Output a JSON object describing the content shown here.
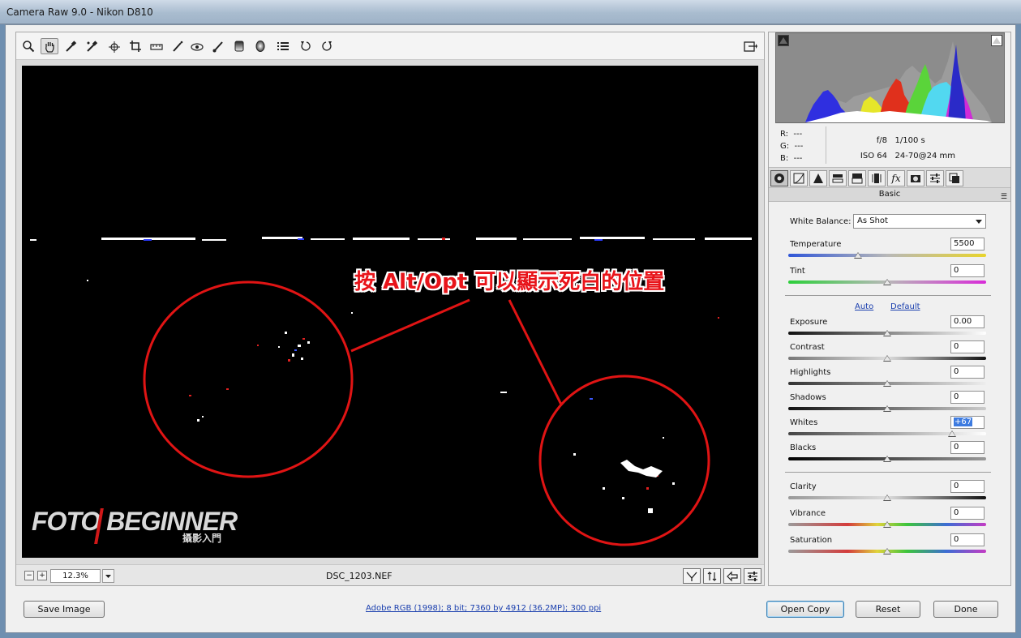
{
  "window": {
    "title": "Camera Raw 9.0  -  Nikon D810"
  },
  "toolbar": {
    "tools": [
      "zoom-icon",
      "hand-icon",
      "white-balance-icon",
      "color-sampler-icon",
      "targeted-adjustment-icon",
      "crop-icon",
      "straighten-icon",
      "spot-removal-icon",
      "red-eye-icon",
      "adjustment-brush-icon",
      "graduated-filter-icon",
      "radial-filter-icon",
      "preferences-icon",
      "rotate-ccw-icon",
      "rotate-cw-icon"
    ],
    "selected_tool": "hand-icon"
  },
  "preview": {
    "annotation": "按 Alt/Opt 可以顯示死白的位置",
    "watermark_main": "FOTO BEGINNER",
    "watermark_sub": "攝影入門"
  },
  "status": {
    "zoom": "12.3%",
    "filename": "DSC_1203.NEF"
  },
  "info": {
    "r_label": "R:",
    "r_value": "---",
    "g_label": "G:",
    "g_value": "---",
    "b_label": "B:",
    "b_value": "---",
    "aperture": "f/8",
    "shutter": "1/100 s",
    "iso": "ISO 64",
    "lens": "24-70@24 mm"
  },
  "panel": {
    "title": "Basic",
    "white_balance_label": "White Balance:",
    "white_balance_value": "As Shot",
    "temperature_label": "Temperature",
    "temperature_value": "5500",
    "tint_label": "Tint",
    "tint_value": "0",
    "auto_label": "Auto",
    "default_label": "Default",
    "exposure_label": "Exposure",
    "exposure_value": "0.00",
    "contrast_label": "Contrast",
    "contrast_value": "0",
    "highlights_label": "Highlights",
    "highlights_value": "0",
    "shadows_label": "Shadows",
    "shadows_value": "0",
    "whites_label": "Whites",
    "whites_value": "+67",
    "blacks_label": "Blacks",
    "blacks_value": "0",
    "clarity_label": "Clarity",
    "clarity_value": "0",
    "vibrance_label": "Vibrance",
    "vibrance_value": "0",
    "saturation_label": "Saturation",
    "saturation_value": "0"
  },
  "bottom": {
    "save_label": "Save Image",
    "workflow_link": "Adobe RGB (1998); 8 bit; 7360 by 4912 (36.2MP); 300 ppi",
    "open_label": "Open Copy",
    "reset_label": "Reset",
    "done_label": "Done"
  }
}
